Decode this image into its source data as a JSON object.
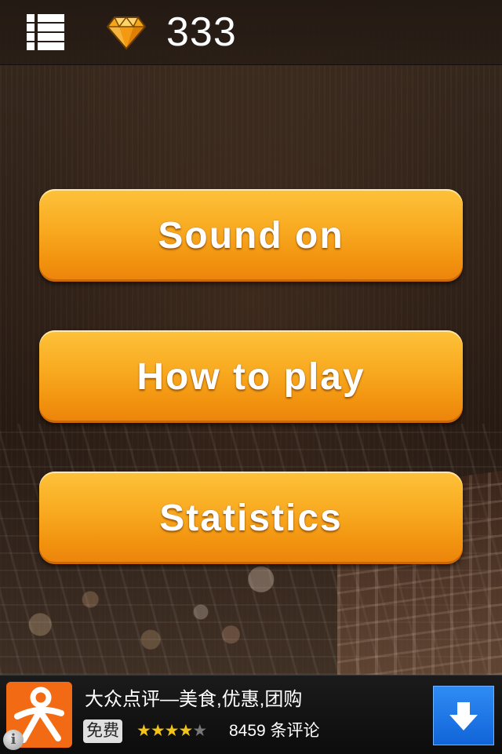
{
  "header": {
    "gem_count": "333",
    "menu_icon": "list-menu-icon",
    "gem_icon": "diamond-icon",
    "gem_color": "#f5a623"
  },
  "menu": {
    "buttons": [
      {
        "label": "Sound on"
      },
      {
        "label": "How to play"
      },
      {
        "label": "Statistics"
      }
    ],
    "button_color": "#f6a01b"
  },
  "ad": {
    "title": "大众点评—美食,优惠,团购",
    "price_tag": "免费",
    "rating": 4,
    "rating_max": 5,
    "rating_stars_filled": "★★★★",
    "rating_stars_empty": "★",
    "review_count": "8459 条评论",
    "download_icon": "download-arrow-icon",
    "info_icon": "info-icon",
    "info_glyph": "i",
    "accent_color": "#1a73e8"
  }
}
